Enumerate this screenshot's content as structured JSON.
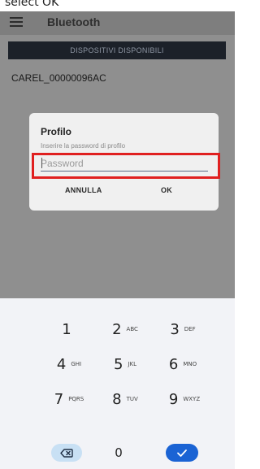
{
  "instruction": "select OK",
  "appbar": {
    "title": "Bluetooth"
  },
  "section_header": "DISPOSITIVI DISPONIBILI",
  "devices": [
    "CAREL_00000096AC"
  ],
  "dialog": {
    "title": "Profilo",
    "subtitle": "Inserire la password di profilo",
    "input_placeholder": "Password",
    "input_value": "",
    "cancel_label": "ANNULLA",
    "ok_label": "OK"
  },
  "keyboard": {
    "keys": [
      {
        "num": "1",
        "letters": ""
      },
      {
        "num": "2",
        "letters": "ABC"
      },
      {
        "num": "3",
        "letters": "DEF"
      },
      {
        "num": "4",
        "letters": "GHI"
      },
      {
        "num": "5",
        "letters": "JKL"
      },
      {
        "num": "6",
        "letters": "MNO"
      },
      {
        "num": "7",
        "letters": "PQRS"
      },
      {
        "num": "8",
        "letters": "TUV"
      },
      {
        "num": "9",
        "letters": "WXYZ"
      },
      {
        "num": "0",
        "letters": ""
      }
    ],
    "icons": {
      "backspace": "backspace-icon",
      "enter": "checkmark-icon"
    }
  },
  "colors": {
    "scrim": "#8f8f8f",
    "section_header_bg": "#1c2129",
    "highlight": "#e02020",
    "enter_key": "#1a63d4",
    "backspace_key": "#c8e0f4",
    "keyboard_bg": "#f2f3f7"
  }
}
